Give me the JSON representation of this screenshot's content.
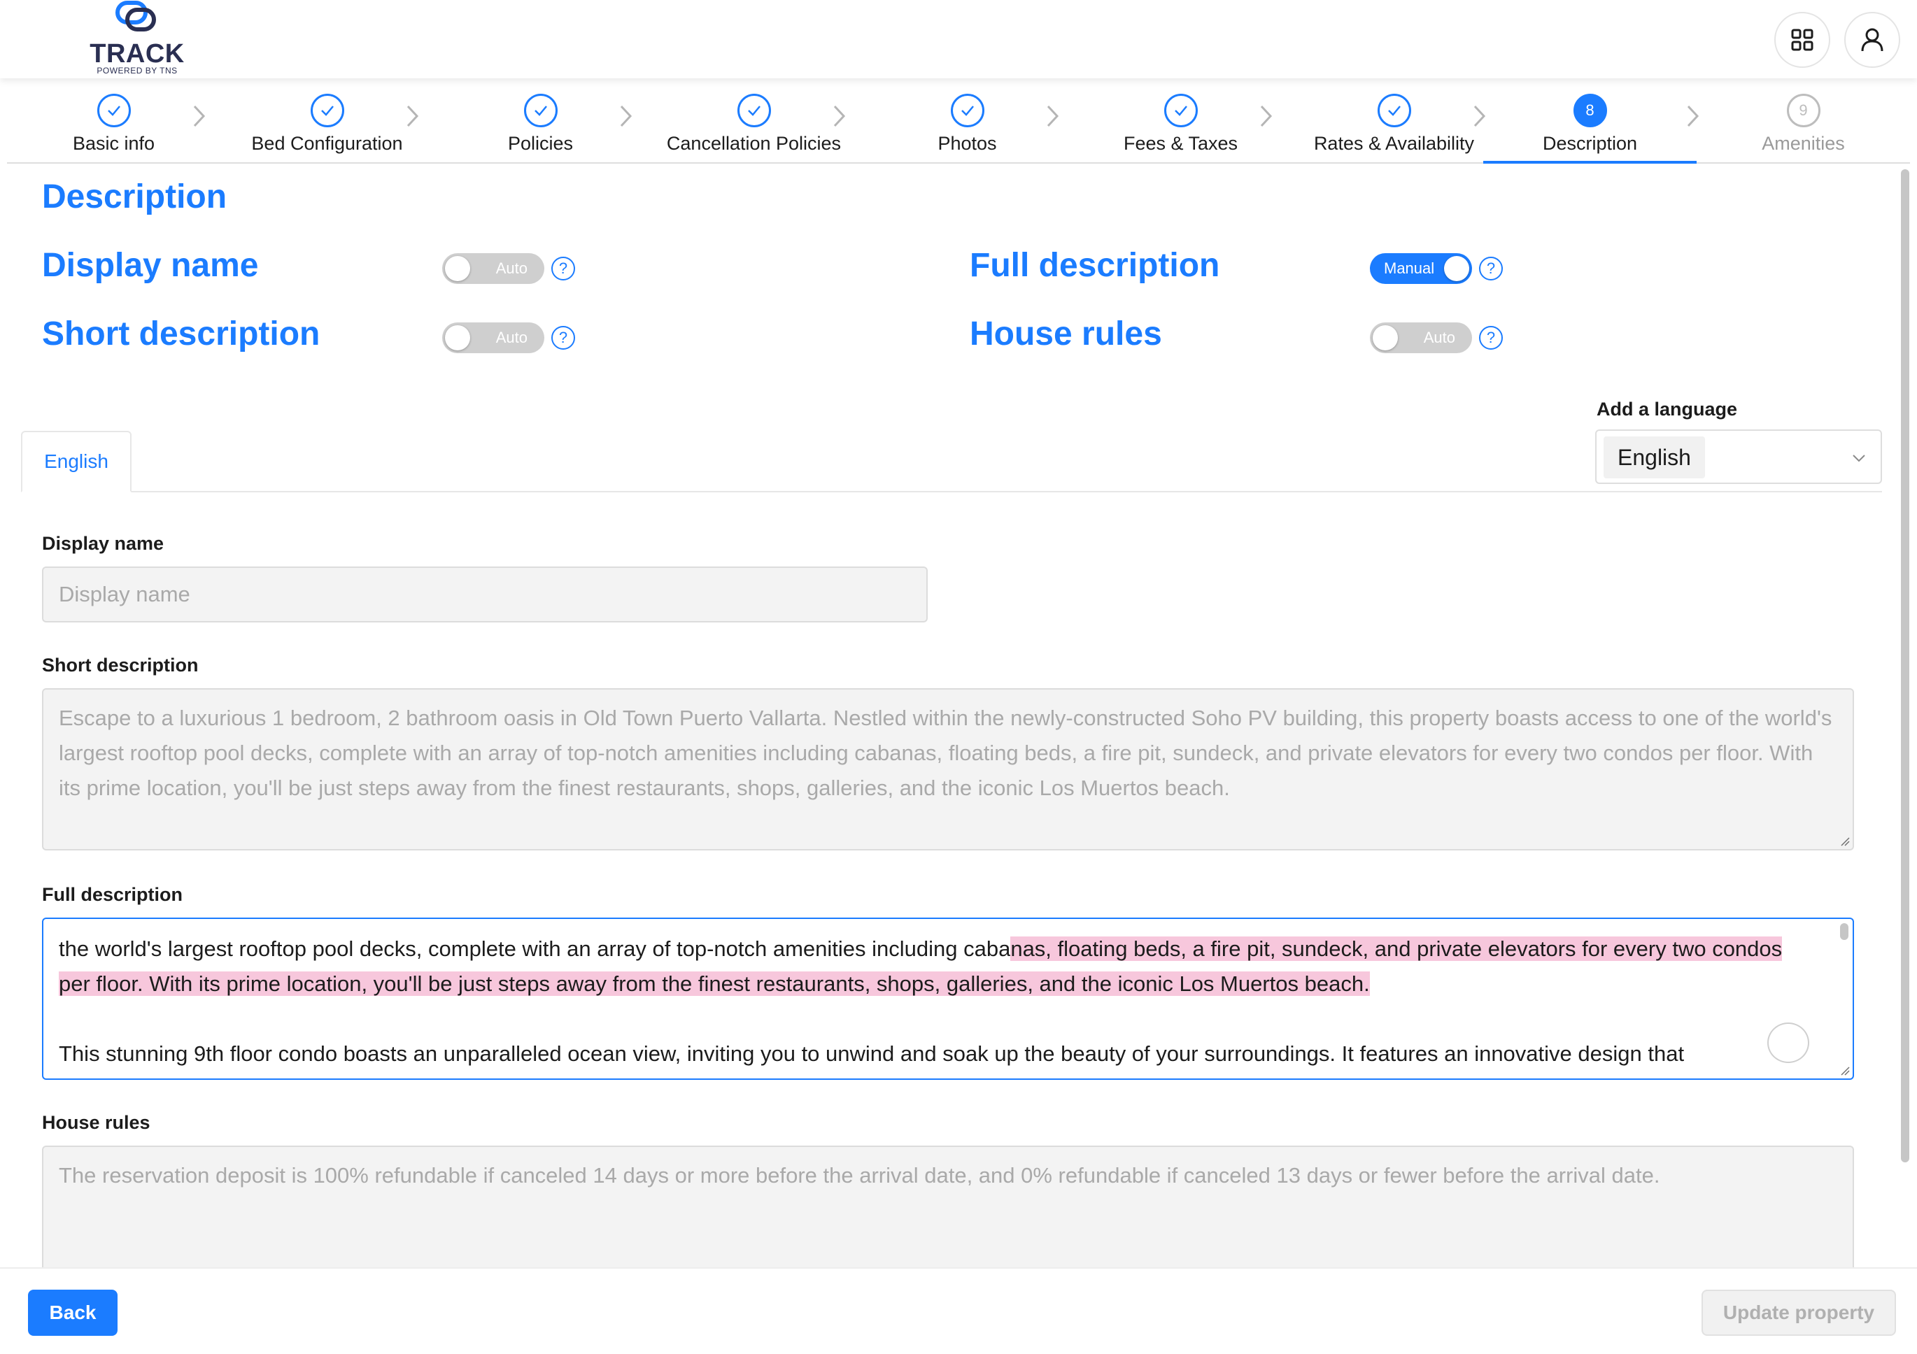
{
  "header": {
    "logo_text": "TRACK",
    "logo_sub": "POWERED BY TNS",
    "icons": [
      "apps-grid-icon",
      "user-icon"
    ]
  },
  "stepper": {
    "steps": [
      {
        "label": "Basic info",
        "state": "done"
      },
      {
        "label": "Bed Configuration",
        "state": "done"
      },
      {
        "label": "Policies",
        "state": "done"
      },
      {
        "label": "Cancellation Policies",
        "state": "done"
      },
      {
        "label": "Photos",
        "state": "done"
      },
      {
        "label": "Fees & Taxes",
        "state": "done"
      },
      {
        "label": "Rates & Availability",
        "state": "done"
      },
      {
        "label": "Description",
        "state": "active",
        "number": "8"
      },
      {
        "label": "Amenities",
        "state": "pending",
        "number": "9"
      }
    ]
  },
  "page_title": "Description",
  "toggles": {
    "display_name": {
      "label": "Display name",
      "mode": "Auto"
    },
    "short_description": {
      "label": "Short description",
      "mode": "Auto"
    },
    "full_description": {
      "label": "Full description",
      "mode": "Manual"
    },
    "house_rules": {
      "label": "House rules",
      "mode": "Auto"
    }
  },
  "language": {
    "add_label": "Add a language",
    "selected": "English",
    "tabs": [
      "English"
    ]
  },
  "form": {
    "display_name_label": "Display name",
    "display_name_placeholder": "Display name",
    "short_label": "Short description",
    "short_value": "Escape to a luxurious 1 bedroom, 2 bathroom oasis in Old Town Puerto Vallarta. Nestled within the newly-constructed Soho PV building, this property boasts access to one of the world's largest rooftop pool decks, complete with an array of top-notch amenities including cabanas, floating beds, a fire pit, sundeck, and private elevators for every two condos per floor. With its prime location, you'll be just steps away from the finest restaurants, shops, galleries, and the iconic Los Muertos beach.",
    "full_label": "Full description",
    "full_value": {
      "para1_start": "the world's largest rooftop pool decks, complete with an array of top-notch amenities including caba",
      "para1_highlight": "nas, floating beds, a fire pit, sundeck, and private elevators for every two condos per floor. With its prime location, you'll be just steps away from the finest restaurants, shops, galleries, and the iconic Los Muertos beach.",
      "para2": "This stunning 9th floor condo boasts an unparalleled ocean view, inviting you to unwind and soak up the beauty of your surroundings. It features an innovative design that"
    },
    "rules_label": "House rules",
    "rules_value": "The reservation deposit is 100% refundable if canceled 14 days or more before the arrival date, and 0% refundable if canceled 13 days or fewer before the arrival date."
  },
  "footer": {
    "back_label": "Back",
    "update_label": "Update property"
  },
  "colors": {
    "accent": "#1b7cff",
    "highlight": "#f7c7dc"
  }
}
